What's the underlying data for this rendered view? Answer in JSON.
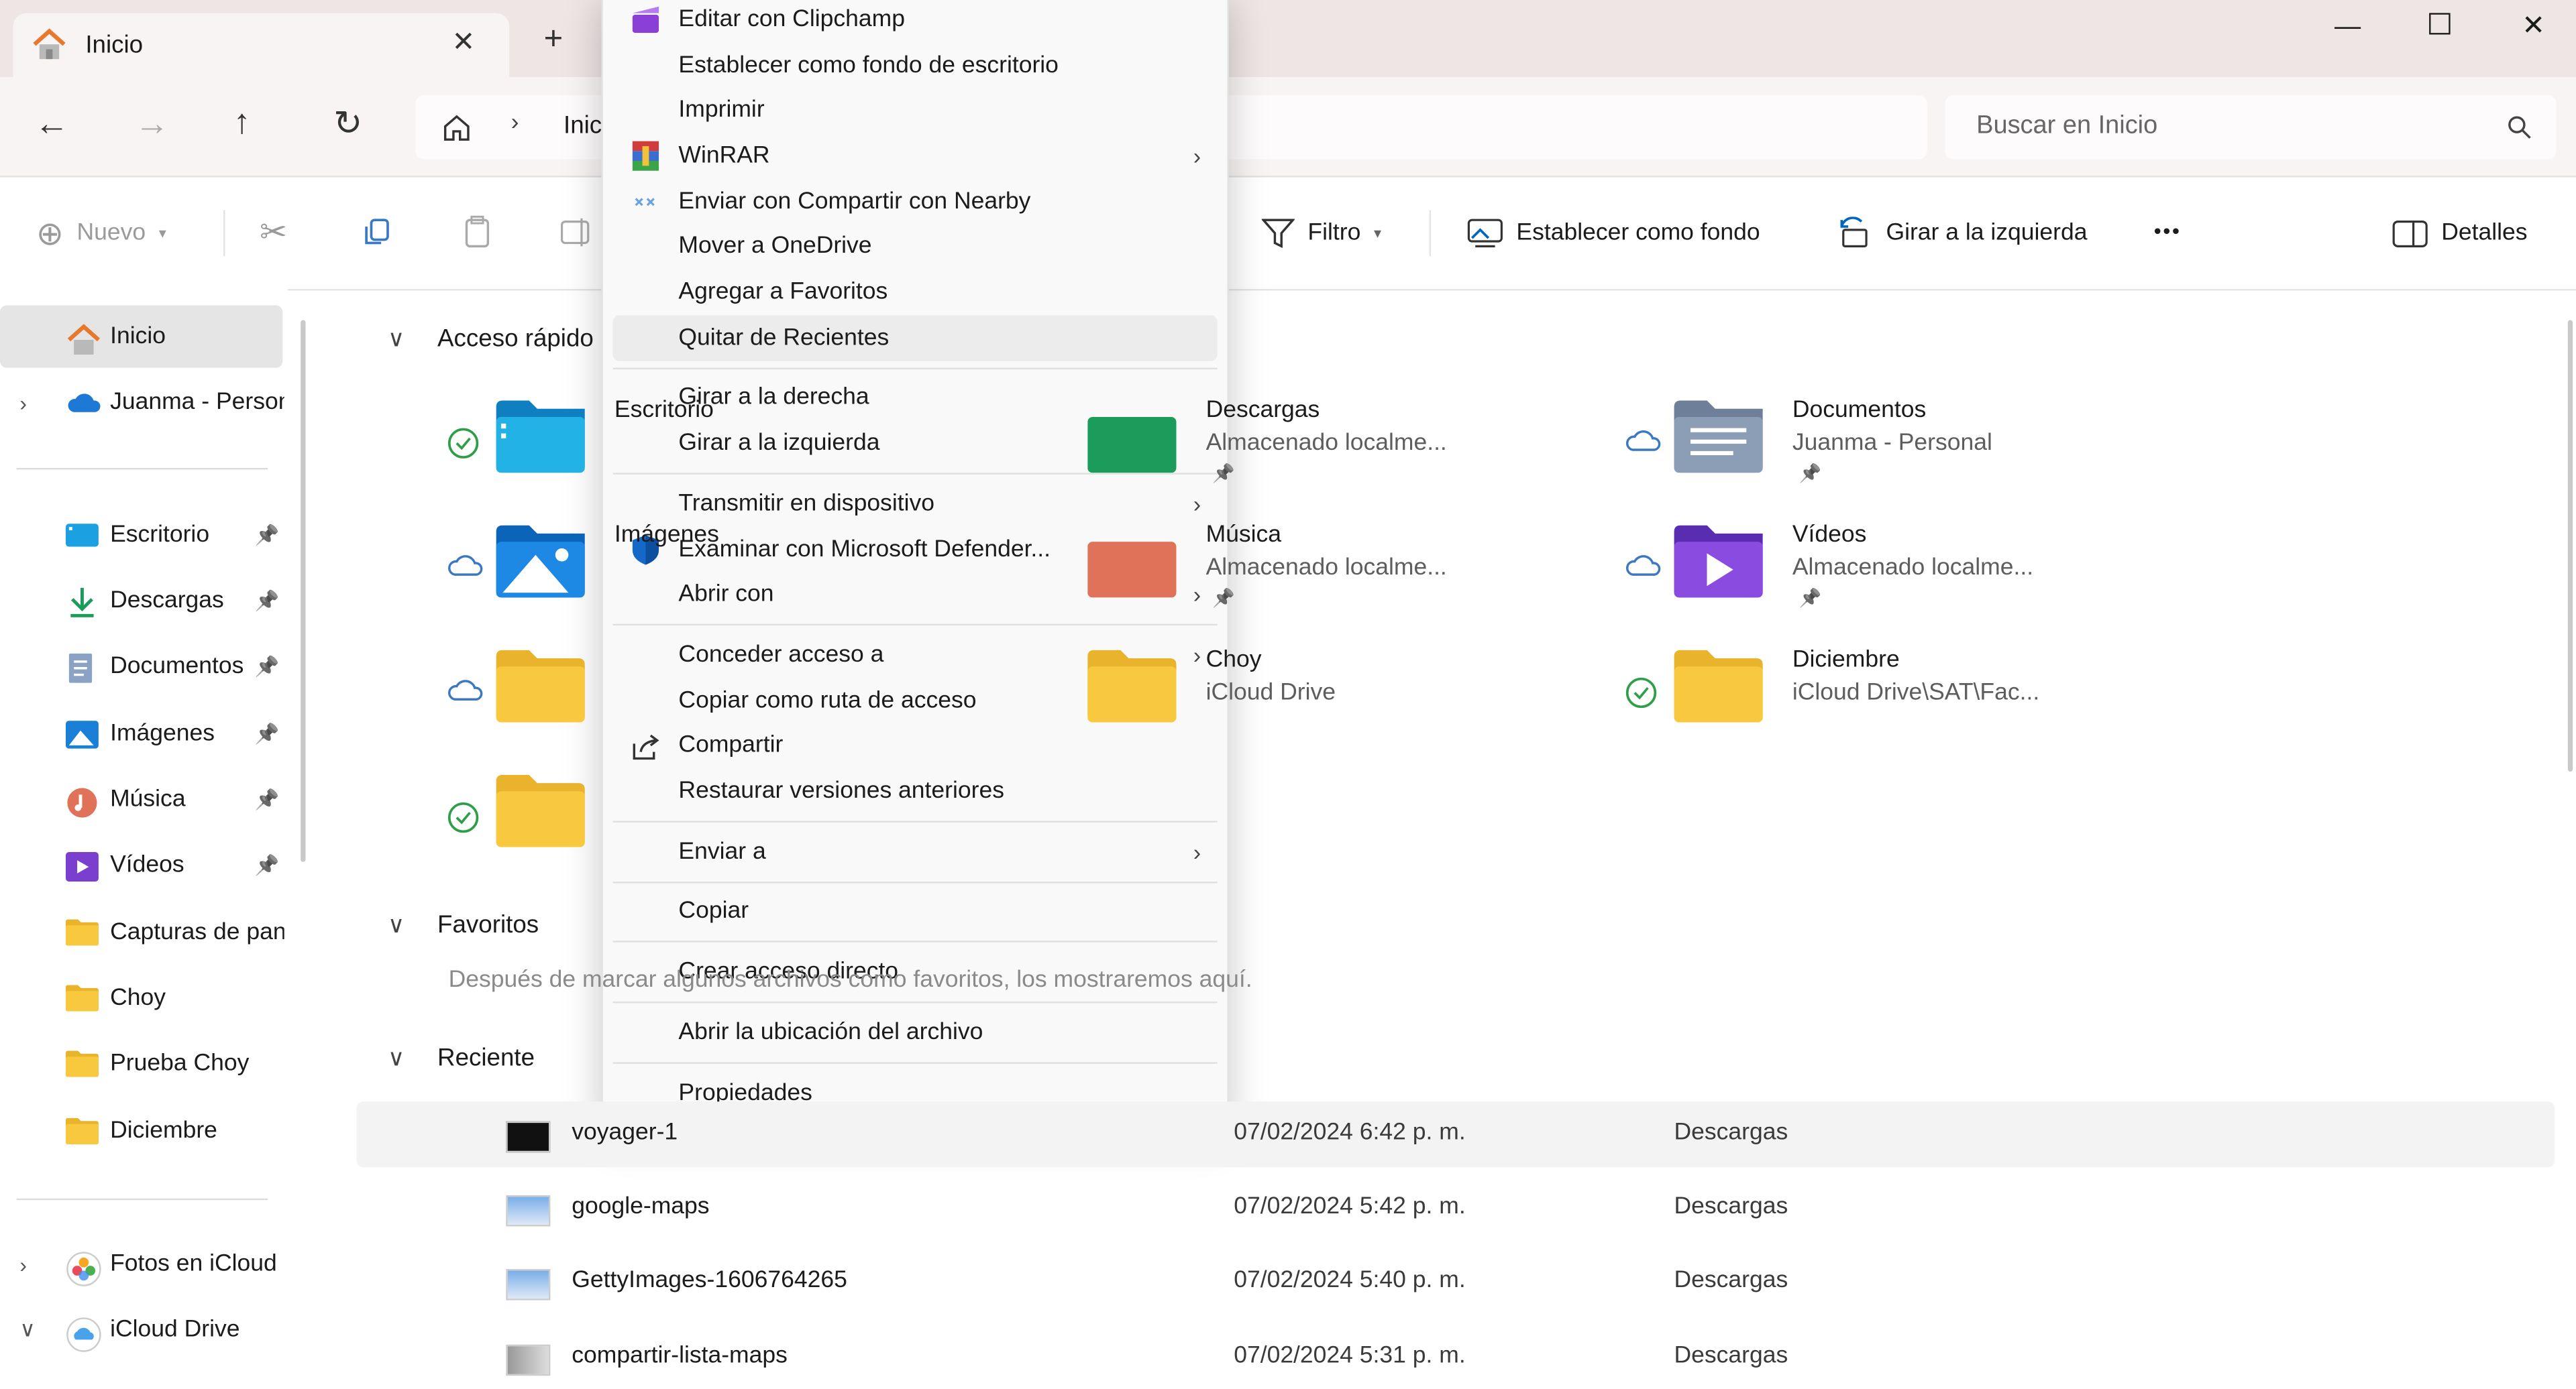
{
  "window": {
    "tab_title": "Inicio",
    "new_tab": "+",
    "controls": {
      "minimize": "—",
      "maximize": "☐",
      "close": "✕"
    }
  },
  "address": {
    "crumb": "Inicio",
    "search_placeholder": "Buscar en Inicio"
  },
  "toolbar": {
    "new_label": "Nuevo",
    "filter_label": "Filtro",
    "set_background": "Establecer como fondo",
    "rotate_left": "Girar a la izquierda",
    "more": "•••",
    "details": "Detalles"
  },
  "sidebar": {
    "items": [
      {
        "label": "Inicio",
        "icon": "home-icon",
        "selected": true
      },
      {
        "label": "Juanma - Personal",
        "icon": "onedrive-cloud-icon",
        "expandable": true
      },
      {
        "label": "Escritorio",
        "icon": "desktop-icon",
        "pinned": true
      },
      {
        "label": "Descargas",
        "icon": "download-icon",
        "pinned": true
      },
      {
        "label": "Documentos",
        "icon": "documents-icon",
        "pinned": true
      },
      {
        "label": "Imágenes",
        "icon": "pictures-icon",
        "pinned": true
      },
      {
        "label": "Música",
        "icon": "music-icon",
        "pinned": true
      },
      {
        "label": "Vídeos",
        "icon": "videos-icon",
        "pinned": true
      },
      {
        "label": "Capturas de pantalla",
        "icon": "folder-icon"
      },
      {
        "label": "Choy",
        "icon": "folder-icon"
      },
      {
        "label": "Prueba Choy",
        "icon": "folder-icon"
      },
      {
        "label": "Diciembre",
        "icon": "folder-icon"
      },
      {
        "label": "Fotos en iCloud",
        "icon": "icloud-photos-icon",
        "expandable": true
      },
      {
        "label": "iCloud Drive",
        "icon": "icloud-drive-icon",
        "expandable": true,
        "expanded": true
      }
    ]
  },
  "main": {
    "quick_access": {
      "title": "Acceso rápido",
      "items": [
        {
          "name": "Escritorio",
          "status": "synced",
          "icon": "desktop-folder-icon"
        },
        {
          "name": "Descargas",
          "sub": "Almacenado localme...",
          "status": "local",
          "icon": "downloads-folder-icon",
          "pinned": true
        },
        {
          "name": "Documentos",
          "sub": "Juanma - Personal",
          "status": "cloud",
          "icon": "documents-folder-icon",
          "pinned": true
        },
        {
          "name": "Imágenes",
          "status": "cloud",
          "icon": "pictures-folder-icon"
        },
        {
          "name": "Música",
          "sub": "Almacenado localme...",
          "status": "local",
          "icon": "music-folder-icon",
          "pinned": true
        },
        {
          "name": "Vídeos",
          "sub": "Almacenado localme...",
          "status": "cloud",
          "icon": "videos-folder-icon",
          "pinned": true
        },
        {
          "name": "",
          "status": "cloud",
          "icon": "folder-icon"
        },
        {
          "name": "Choy",
          "sub": "iCloud Drive",
          "status": "local",
          "icon": "folder-icon"
        },
        {
          "name": "Diciembre",
          "sub": "iCloud Drive\\SAT\\Fac...",
          "status": "synced",
          "icon": "folder-icon"
        },
        {
          "name": "",
          "status": "synced",
          "icon": "folder-icon"
        }
      ]
    },
    "favorites": {
      "title": "Favoritos",
      "empty_text": "Después de marcar algunos archivos como favoritos, los mostraremos aquí."
    },
    "recent": {
      "title": "Reciente",
      "rows": [
        {
          "name": "voyager-1",
          "date": "07/02/2024 6:42 p. m.",
          "location": "Descargas",
          "selected": true,
          "thumb": "dark"
        },
        {
          "name": "google-maps",
          "date": "07/02/2024 5:42 p. m.",
          "location": "Descargas",
          "thumb": "map"
        },
        {
          "name": "GettyImages-1606764265",
          "date": "07/02/2024 5:40 p. m.",
          "location": "Descargas",
          "thumb": "map"
        },
        {
          "name": "compartir-lista-maps",
          "date": "07/02/2024 5:31 p. m.",
          "location": "Descargas",
          "thumb": "gray"
        }
      ]
    }
  },
  "context_menu": {
    "groups": [
      [
        {
          "label": "Editar con Clipchamp",
          "icon": "clipchamp-icon"
        },
        {
          "label": "Establecer como fondo de escritorio"
        },
        {
          "label": "Imprimir"
        },
        {
          "label": "WinRAR",
          "icon": "winrar-icon",
          "submenu": true
        },
        {
          "label": "Enviar con Compartir con Nearby",
          "icon": "nearby-share-icon"
        },
        {
          "label": "Mover a OneDrive"
        },
        {
          "label": "Agregar a Favoritos"
        },
        {
          "label": "Quitar de Recientes",
          "hover": true
        }
      ],
      [
        {
          "label": "Girar a la derecha"
        },
        {
          "label": "Girar a la izquierda"
        }
      ],
      [
        {
          "label": "Transmitir en dispositivo",
          "submenu": true
        },
        {
          "label": "Examinar con Microsoft Defender...",
          "icon": "defender-shield-icon"
        },
        {
          "label": "Abrir con",
          "submenu": true
        }
      ],
      [
        {
          "label": "Conceder acceso a",
          "submenu": true
        },
        {
          "label": "Copiar como ruta de acceso"
        },
        {
          "label": "Compartir",
          "icon": "share-icon"
        },
        {
          "label": "Restaurar versiones anteriores"
        }
      ],
      [
        {
          "label": "Enviar a",
          "submenu": true
        }
      ],
      [
        {
          "label": "Copiar"
        }
      ],
      [
        {
          "label": "Crear acceso directo"
        }
      ],
      [
        {
          "label": "Abrir la ubicación del archivo"
        }
      ],
      [
        {
          "label": "Propiedades"
        }
      ]
    ]
  },
  "colors": {
    "accent": "#0067c0",
    "folder": "#f8c93e",
    "synced": "#2e9e48",
    "cloud": "#3b78c4"
  }
}
